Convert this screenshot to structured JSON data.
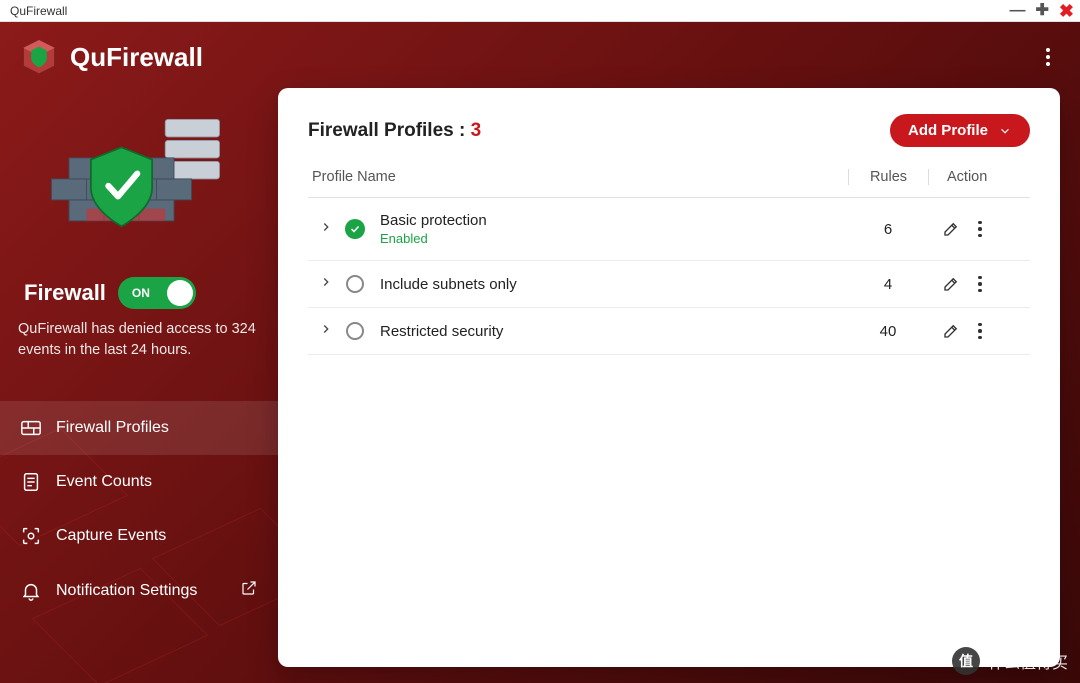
{
  "window": {
    "title": "QuFirewall"
  },
  "header": {
    "app_name": "QuFirewall"
  },
  "sidebar": {
    "firewall_label": "Firewall",
    "toggle_state": "ON",
    "status_text": "QuFirewall has denied access to 324 events in the last 24 hours.",
    "nav": [
      {
        "label": "Firewall Profiles",
        "active": true,
        "external": false
      },
      {
        "label": "Event Counts",
        "active": false,
        "external": false
      },
      {
        "label": "Capture Events",
        "active": false,
        "external": false
      },
      {
        "label": "Notification Settings",
        "active": false,
        "external": true
      }
    ]
  },
  "main": {
    "title_prefix": "Firewall Profiles : ",
    "profile_count": "3",
    "add_button_label": "Add Profile",
    "columns": {
      "name": "Profile Name",
      "rules": "Rules",
      "action": "Action"
    },
    "profiles": [
      {
        "name": "Basic protection",
        "status": "Enabled",
        "enabled": true,
        "rules": "6"
      },
      {
        "name": "Include subnets only",
        "status": "",
        "enabled": false,
        "rules": "4"
      },
      {
        "name": "Restricted security",
        "status": "",
        "enabled": false,
        "rules": "40"
      }
    ]
  },
  "watermark": {
    "text": "什么值得买"
  }
}
